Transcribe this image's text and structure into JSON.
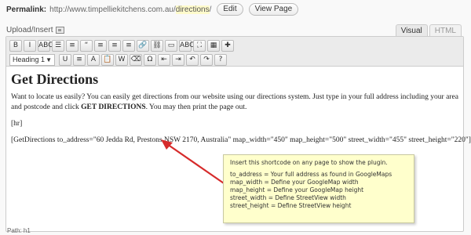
{
  "permalink": {
    "label": "Permalink:",
    "base_url": "http://www.timpelliekitchens.com.au/",
    "slug": "directions",
    "trailing": "/",
    "edit_label": "Edit",
    "view_label": "View Page"
  },
  "upload": {
    "label": "Upload/Insert",
    "icon": "media-icon"
  },
  "tabs": [
    {
      "label": "Visual"
    },
    {
      "label": "HTML"
    }
  ],
  "toolbar": {
    "row1": [
      {
        "name": "bold-button",
        "glyph": "B"
      },
      {
        "name": "italic-button",
        "glyph": "I"
      },
      {
        "name": "strikethrough-button",
        "glyph": "ABC"
      },
      {
        "name": "bullet-list-button",
        "glyph": "☰"
      },
      {
        "name": "numbered-list-button",
        "glyph": "≡"
      },
      {
        "name": "blockquote-button",
        "glyph": "“"
      },
      {
        "name": "align-left-button",
        "glyph": "≡"
      },
      {
        "name": "align-center-button",
        "glyph": "≡"
      },
      {
        "name": "align-right-button",
        "glyph": "≡"
      },
      {
        "name": "insert-link-button",
        "glyph": "🔗"
      },
      {
        "name": "unlink-button",
        "glyph": "⛓"
      },
      {
        "name": "insert-more-button",
        "glyph": "▭"
      },
      {
        "name": "spellcheck-button",
        "glyph": "ABC✓"
      },
      {
        "name": "fullscreen-button",
        "glyph": "⛶"
      },
      {
        "name": "toggle-kitchen-sink-button",
        "glyph": "▦"
      },
      {
        "name": "plugin-button",
        "glyph": "✚"
      }
    ],
    "format_select": "Heading 1",
    "row2": [
      {
        "name": "underline-button",
        "glyph": "U"
      },
      {
        "name": "justify-button",
        "glyph": "≡"
      },
      {
        "name": "text-color-button",
        "glyph": "A"
      },
      {
        "name": "paste-text-button",
        "glyph": "📋"
      },
      {
        "name": "paste-word-button",
        "glyph": "W"
      },
      {
        "name": "remove-format-button",
        "glyph": "⌫"
      },
      {
        "name": "special-char-button",
        "glyph": "Ω"
      },
      {
        "name": "outdent-button",
        "glyph": "⇤"
      },
      {
        "name": "indent-button",
        "glyph": "⇥"
      },
      {
        "name": "undo-button",
        "glyph": "↶"
      },
      {
        "name": "redo-button",
        "glyph": "↷"
      },
      {
        "name": "help-button",
        "glyph": "?"
      }
    ]
  },
  "content": {
    "heading": "Get Directions",
    "intro_pre": "Want to locate us easily? You can easily get directions from our website using our directions system. Just type in your full address including your area and postcode and click ",
    "intro_bold": "GET DIRECTIONS",
    "intro_post": ". You may then print the page out.",
    "hr": "[hr]",
    "shortcode": "[GetDirections to_address=\"60 Jedda Rd, Prestons NSW 2170, Australia\" map_width=\"450\" map_height=\"500\" street_width=\"455\" street_height=\"220\"]"
  },
  "status": {
    "path_label": "Path:",
    "path_value": "h1"
  },
  "note": {
    "title": "Insert this shortcode on any page to show the plugin.",
    "lines": [
      "to_address = Your full address as found in GoogleMaps",
      "map_width = Define your GoogleMap width",
      "map_height = Define your GoogleMap height",
      "street_width = Define StreetView width",
      "street_height = Define StreetView height"
    ]
  },
  "colors": {
    "arrow": "#d62b2b",
    "note_bg": "#ffffcc"
  }
}
